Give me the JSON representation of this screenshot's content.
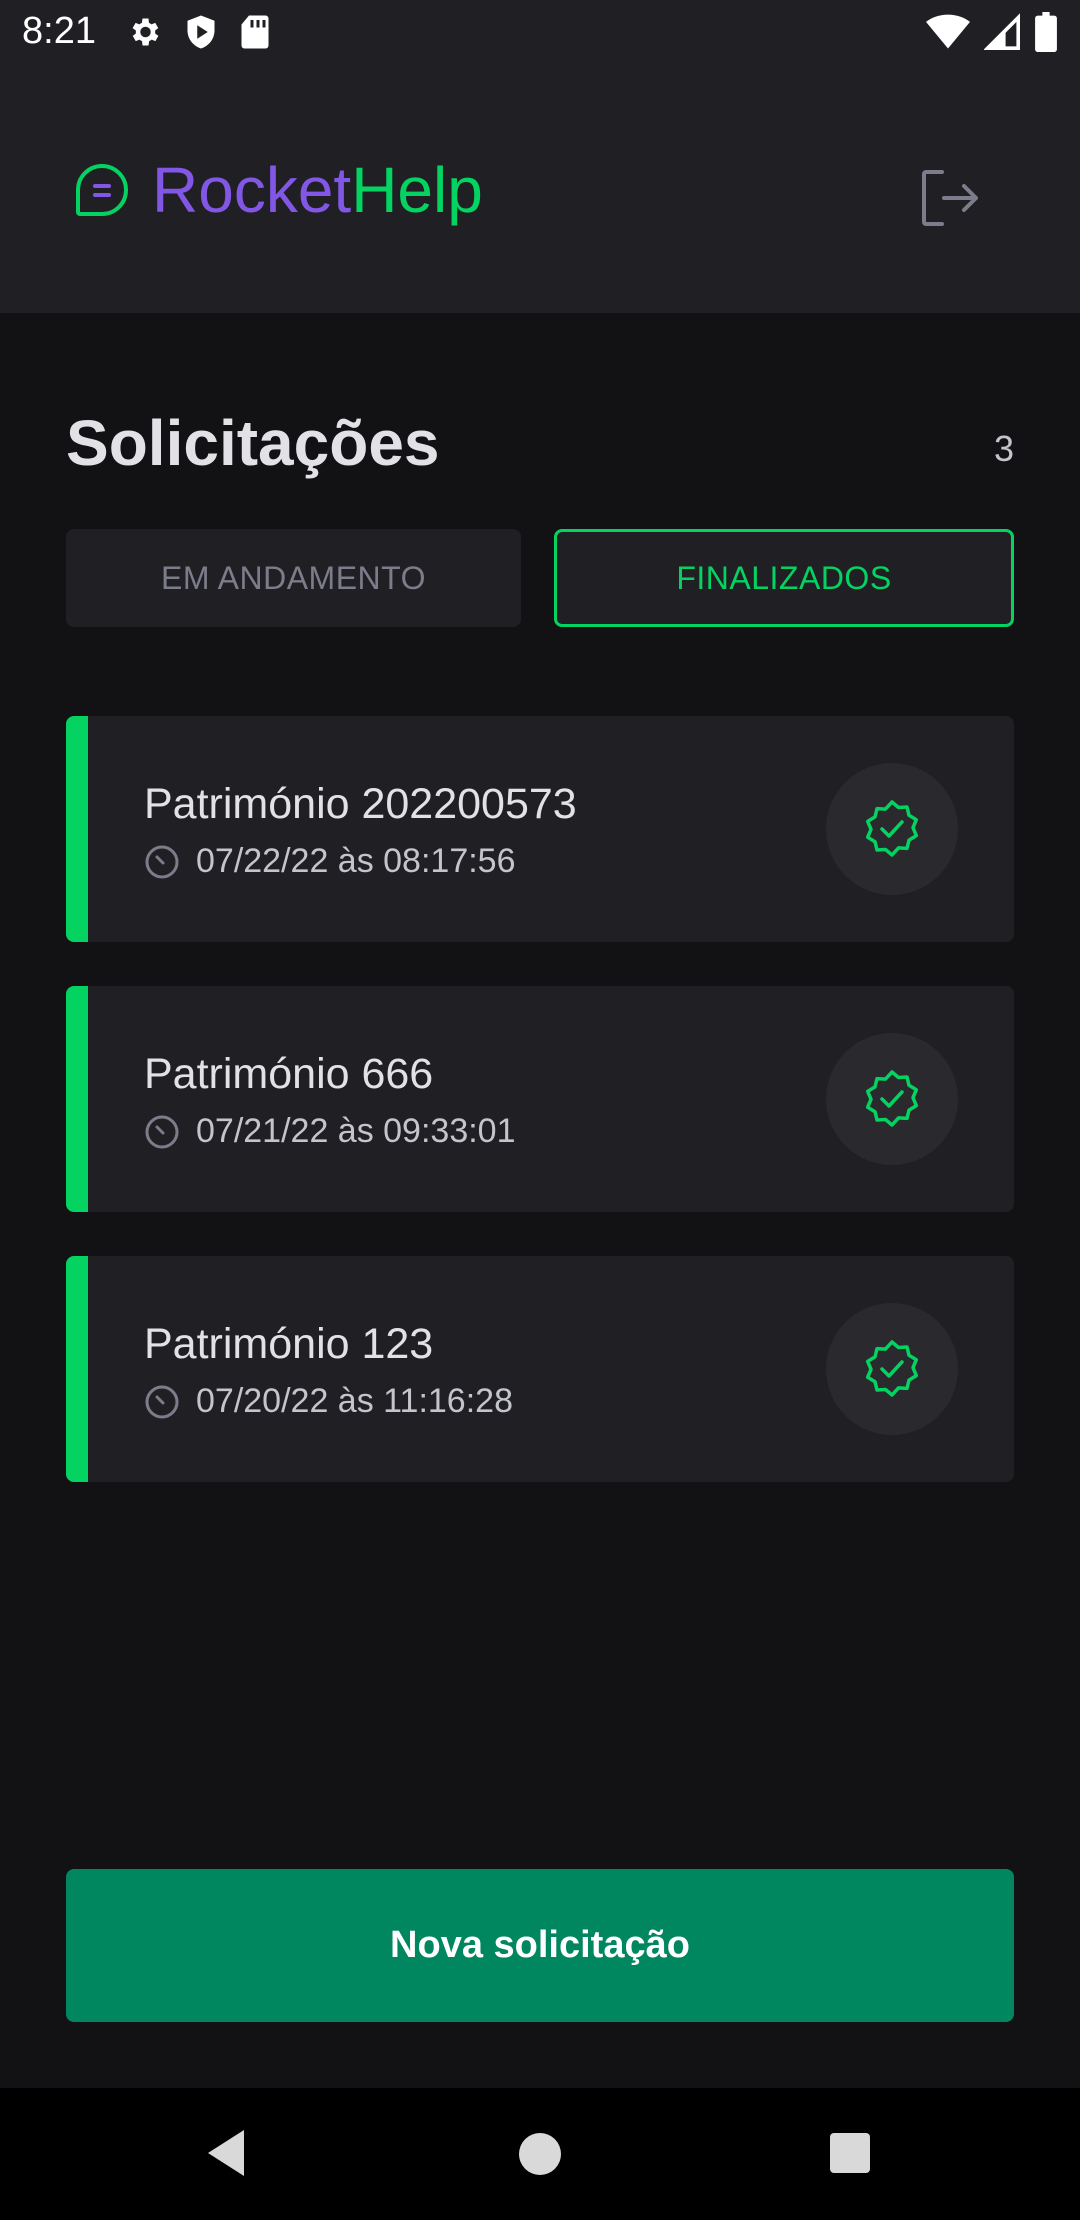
{
  "status_bar": {
    "time": "8:21",
    "left_icons": [
      "gear-icon",
      "shield-play-icon",
      "sd-card-icon"
    ],
    "right_icons": [
      "wifi-icon",
      "cell-signal-icon",
      "battery-icon"
    ]
  },
  "header": {
    "logo_part1": "Rocket",
    "logo_part2": "Help",
    "logo_icon": "chat-bubble-icon",
    "logout_icon": "sign-out-icon",
    "colors": {
      "rocket": "#8257E5",
      "help": "#04D361"
    }
  },
  "main": {
    "title": "Solicitações",
    "count": "3",
    "filters": {
      "open_label": "EM ANDAMENTO",
      "closed_label": "FINALIZADOS",
      "selected": "closed"
    },
    "requests": [
      {
        "title": "Património 202200573",
        "date": "07/22/22 às 08:17:56",
        "status": "closed"
      },
      {
        "title": "Património 666",
        "date": "07/21/22 às 09:33:01",
        "status": "closed"
      },
      {
        "title": "Património 123",
        "date": "07/20/22 às 11:16:28",
        "status": "closed"
      }
    ],
    "new_button_label": "Nova solicitação"
  },
  "colors": {
    "accent": "#04D361",
    "button": "#00875F",
    "card": "#202024",
    "background": "#121214"
  },
  "nav_bar": {
    "icons": [
      "back-icon",
      "home-icon",
      "recent-apps-icon"
    ]
  }
}
